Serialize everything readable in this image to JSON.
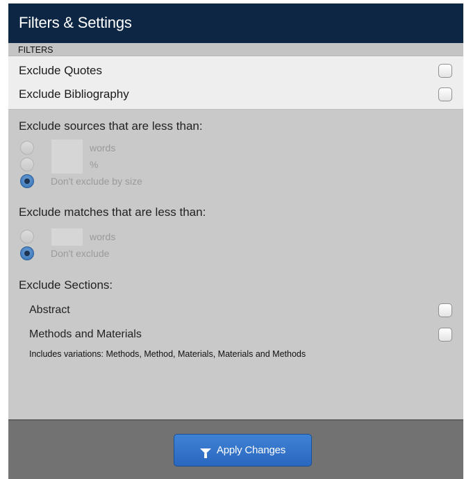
{
  "header": {
    "title": "Filters & Settings"
  },
  "filters": {
    "section_label": "FILTERS",
    "exclude_quotes": {
      "label": "Exclude Quotes",
      "checked": false
    },
    "exclude_bibliography": {
      "label": "Exclude Bibliography",
      "checked": false
    }
  },
  "sources": {
    "title": "Exclude sources that are less than:",
    "options": [
      {
        "label": "words",
        "value": "",
        "selected": false
      },
      {
        "label": "%",
        "value": "",
        "selected": false
      },
      {
        "label": "Don't exclude by size",
        "selected": true
      }
    ]
  },
  "matches": {
    "title": "Exclude matches that are less than:",
    "options": [
      {
        "label": "words",
        "value": "",
        "selected": false
      },
      {
        "label": "Don't exclude",
        "selected": true
      }
    ]
  },
  "sections": {
    "title": "Exclude Sections:",
    "items": [
      {
        "label": "Abstract",
        "checked": false
      },
      {
        "label": "Methods and Materials",
        "checked": false
      }
    ],
    "note": "Includes variations: Methods, Method, Materials, Materials and Methods"
  },
  "footer": {
    "apply_label": "Apply Changes",
    "icon": "funnel-icon"
  }
}
